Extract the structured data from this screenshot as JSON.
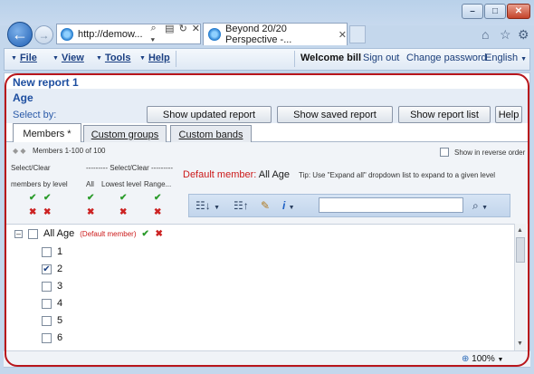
{
  "browser": {
    "address": "http://demow...",
    "address_tools": [
      "⌕ ▾",
      "▤",
      "↻",
      "✕"
    ],
    "tab_title": "Beyond 20/20 Perspective -...",
    "tab_close": "✕",
    "right_icons": [
      "home-icon",
      "star-icon",
      "gear-icon"
    ]
  },
  "menu": {
    "items": [
      {
        "label": "File"
      },
      {
        "label": "View"
      },
      {
        "label": "Tools"
      },
      {
        "label": "Help"
      }
    ],
    "welcome": "Welcome bill",
    "sign_out": "Sign out",
    "change_password": "Change password",
    "language": "English"
  },
  "report": {
    "title": "New report 1",
    "dimension": "Age",
    "select_by": "Select by:",
    "buttons": {
      "show_updated": "Show updated report",
      "show_saved": "Show saved report",
      "show_list": "Show report list",
      "help": "Help"
    },
    "tabs": [
      {
        "label": "Members *"
      },
      {
        "label": "Custom groups"
      },
      {
        "label": "Custom bands"
      }
    ],
    "members_range": "Members 1-100 of 100",
    "reverse_order": "Show in reverse order",
    "select_clear_level": "Select/Clear",
    "members_by_level": "members by level",
    "select_clear_header": "Select/Clear",
    "col_all": "All",
    "col_lowest": "Lowest level",
    "col_range": "Range...",
    "default_member_label": "Default member:",
    "default_member_value": "All Age",
    "tip": "Tip: Use \"Expand all\" dropdown list to expand to a given level",
    "search_value": ""
  },
  "tree": {
    "root_label": "All Age",
    "root_tag": "(Default member)",
    "rows": [
      {
        "label": "1",
        "checked": false
      },
      {
        "label": "2",
        "checked": true
      },
      {
        "label": "3",
        "checked": false
      },
      {
        "label": "4",
        "checked": false
      },
      {
        "label": "5",
        "checked": false
      },
      {
        "label": "6",
        "checked": false
      }
    ]
  },
  "status": {
    "zoom": "100%"
  }
}
